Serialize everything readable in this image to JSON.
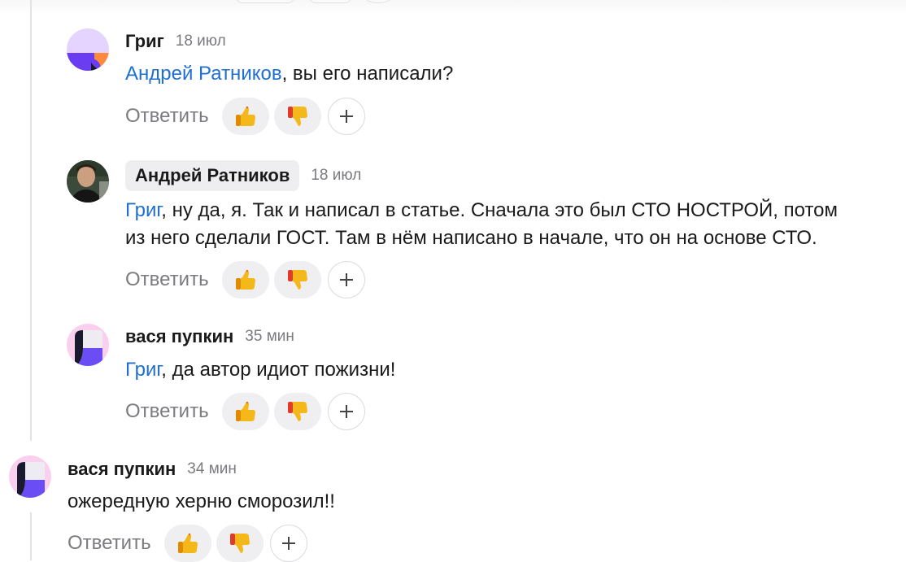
{
  "comments": [
    {
      "author": "Григ",
      "time": "18 июл",
      "mention": "Андрей Ратников",
      "text": ", вы его написали?",
      "reply_label": "Ответить"
    },
    {
      "author": "Андрей Ратников",
      "time": "18 июл",
      "mention": "Григ",
      "text_line1": ", ну да, я. Так и написал в статье. Сначала это был СТО НОСТРОЙ, потом",
      "text_line2": "из него сделали ГОСТ. Там в нём написано в начале, что он на основе СТО.",
      "reply_label": "Ответить"
    },
    {
      "author": "вася пупкин",
      "time": "35 мин",
      "mention": "Григ",
      "text": ", да автор идиот пожизни!",
      "reply_label": "Ответить"
    },
    {
      "author": "вася пупкин",
      "time": "34 мин",
      "text": "ожередную херню сморозил!!",
      "reply_label": "Ответить"
    }
  ],
  "icons": {
    "like": "thumbs-up-icon",
    "dislike": "thumbs-down-icon",
    "add_reaction": "plus-icon"
  },
  "colors": {
    "mention": "#1f6fd1",
    "muted": "#7b7b80",
    "reaction_bg": "#efeff1"
  }
}
